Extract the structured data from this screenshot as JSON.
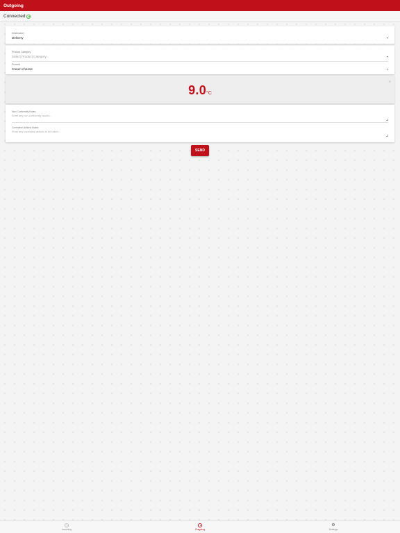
{
  "appbar": {
    "title": "Outgoing",
    "color": "#c0111a"
  },
  "status": {
    "label": "Connected",
    "icon": "check-circle-icon",
    "color": "#3cb043"
  },
  "destination": {
    "label": "Destination",
    "value": "Delivery"
  },
  "product_category": {
    "label": "Product Category",
    "placeholder": "Select Product Category..."
  },
  "product": {
    "label": "Product",
    "value": "Cream cheese"
  },
  "temperature": {
    "value": "9.0",
    "unit": "°C",
    "badge": "⟳"
  },
  "non_conformity": {
    "label": "Non Conformity Notes",
    "placeholder": "Enter any non-conformity issues..."
  },
  "corrective_action": {
    "label": "Corrective Actions Notes",
    "placeholder": "Enter any corrective actions to be taken..."
  },
  "send_button": {
    "label": "SEND"
  },
  "bottom_nav": {
    "items": [
      {
        "label": "Incoming",
        "icon": "incoming-icon",
        "active": false
      },
      {
        "label": "Outgoing",
        "icon": "outgoing-icon",
        "active": true
      },
      {
        "label": "Settings",
        "icon": "gear-icon",
        "active": false
      }
    ]
  }
}
